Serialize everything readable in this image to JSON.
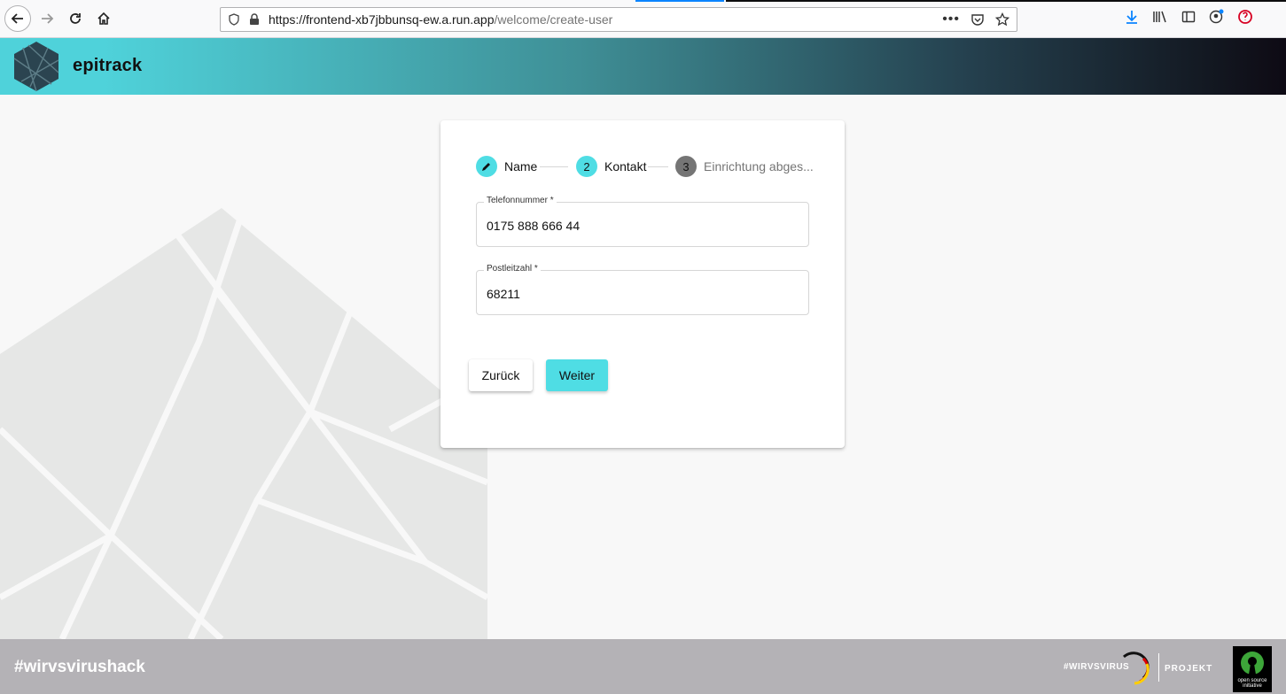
{
  "browser": {
    "url_host": "https://frontend-xb7jbbunsq-ew.a.run.app",
    "url_path": "/welcome/create-user"
  },
  "app": {
    "brand": "epitrack"
  },
  "stepper": {
    "steps": [
      {
        "label": "Name",
        "number": "",
        "state": "edit"
      },
      {
        "label": "Kontakt",
        "number": "2",
        "state": "active"
      },
      {
        "label": "Einrichtung abges...",
        "number": "3",
        "state": "inactive"
      }
    ]
  },
  "form": {
    "phone": {
      "label": "Telefonnummer *",
      "value": "0175 888 666 44"
    },
    "zip": {
      "label": "Postleitzahl *",
      "value": "68211"
    }
  },
  "buttons": {
    "back_label": "Zurück",
    "next_label": "Weiter"
  },
  "footer": {
    "hashtag": "#wirvsvirushack",
    "wvv_text": "#WIRVSVIRUS",
    "projekt": "PROJEKT",
    "osi_text": "open source initiative"
  },
  "colors": {
    "accent": "#4fdde4",
    "header_start": "#4fd2da",
    "header_end": "#0e0a14",
    "footer_bg": "#b4b2b6"
  }
}
